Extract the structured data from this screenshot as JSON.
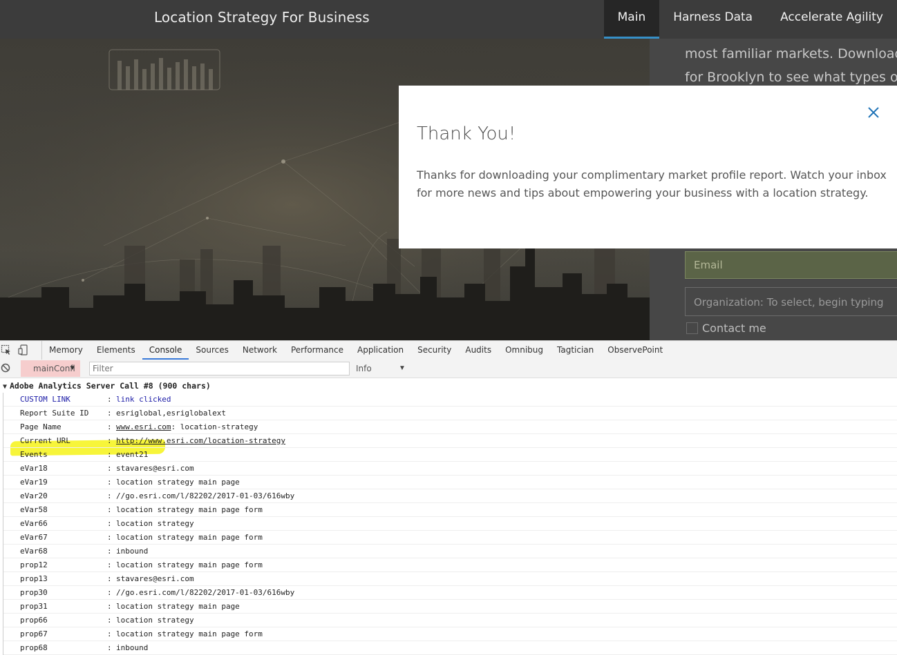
{
  "nav": {
    "title": "Location Strategy For Business",
    "links": [
      {
        "label": "Main",
        "active": true
      },
      {
        "label": "Harness Data",
        "active": false
      },
      {
        "label": "Accelerate Agility",
        "active": false
      }
    ]
  },
  "right_panel": {
    "intro_line_1": "most familiar markets. Download a",
    "intro_line_2": "for Brooklyn to see what types of i",
    "email_placeholder": "Email",
    "org_placeholder": "Organization: To select, begin typing",
    "contact_label": "Contact me"
  },
  "modal": {
    "title": "Thank You!",
    "body": "Thanks for downloading your complimentary market profile report. Watch your inbox for more news and tips about empowering your business with a location strategy."
  },
  "devtools": {
    "tabs": [
      {
        "label": "Memory",
        "active": false
      },
      {
        "label": "Elements",
        "active": false
      },
      {
        "label": "Console",
        "active": true
      },
      {
        "label": "Sources",
        "active": false
      },
      {
        "label": "Network",
        "active": false
      },
      {
        "label": "Performance",
        "active": false
      },
      {
        "label": "Application",
        "active": false
      },
      {
        "label": "Security",
        "active": false
      },
      {
        "label": "Audits",
        "active": false
      },
      {
        "label": "Omnibug",
        "active": false
      },
      {
        "label": "Tagtician",
        "active": false
      },
      {
        "label": "ObservePoint",
        "active": false
      }
    ],
    "context": "mainConfi",
    "filter_placeholder": "Filter",
    "level": "Info",
    "log_title": "Adobe Analytics Server Call #8 (900 chars)",
    "rows": [
      {
        "key": "CUSTOM LINK",
        "value": "link clicked",
        "style": "blue"
      },
      {
        "key": "Report Suite ID",
        "value": "esriglobal,esriglobalext"
      },
      {
        "key": "Page Name",
        "value": "www.esri.com: location-strategy",
        "link_part": "www.esri.com",
        "rest_part": ": location-strategy"
      },
      {
        "key": "Current URL",
        "value": "http://www.esri.com/location-strategy",
        "link_part": "http://www.esri.com/location-strategy",
        "rest_part": ""
      },
      {
        "key": "Events",
        "value": "event21",
        "highlighted": true
      },
      {
        "key": "eVar18",
        "value": "stavares@esri.com"
      },
      {
        "key": "eVar19",
        "value": "location strategy main page"
      },
      {
        "key": "eVar20",
        "value": "//go.esri.com/l/82202/2017-01-03/616wby"
      },
      {
        "key": "eVar58",
        "value": "location strategy main page form"
      },
      {
        "key": "eVar66",
        "value": "location strategy"
      },
      {
        "key": "eVar67",
        "value": "location strategy main page form"
      },
      {
        "key": "eVar68",
        "value": "inbound"
      },
      {
        "key": "prop12",
        "value": "location strategy main page form"
      },
      {
        "key": "prop13",
        "value": "stavares@esri.com"
      },
      {
        "key": "prop30",
        "value": "//go.esri.com/l/82202/2017-01-03/616wby"
      },
      {
        "key": "prop31",
        "value": "location strategy main page"
      },
      {
        "key": "prop66",
        "value": "location strategy"
      },
      {
        "key": "prop67",
        "value": "location strategy main page form"
      },
      {
        "key": "prop68",
        "value": "inbound"
      }
    ],
    "separator": ":"
  },
  "colors": {
    "nav_bg": "#3c3c3c",
    "nav_active_underline": "#3690c8",
    "highlight": "#f7f53a",
    "close_icon": "#1f73b7"
  }
}
